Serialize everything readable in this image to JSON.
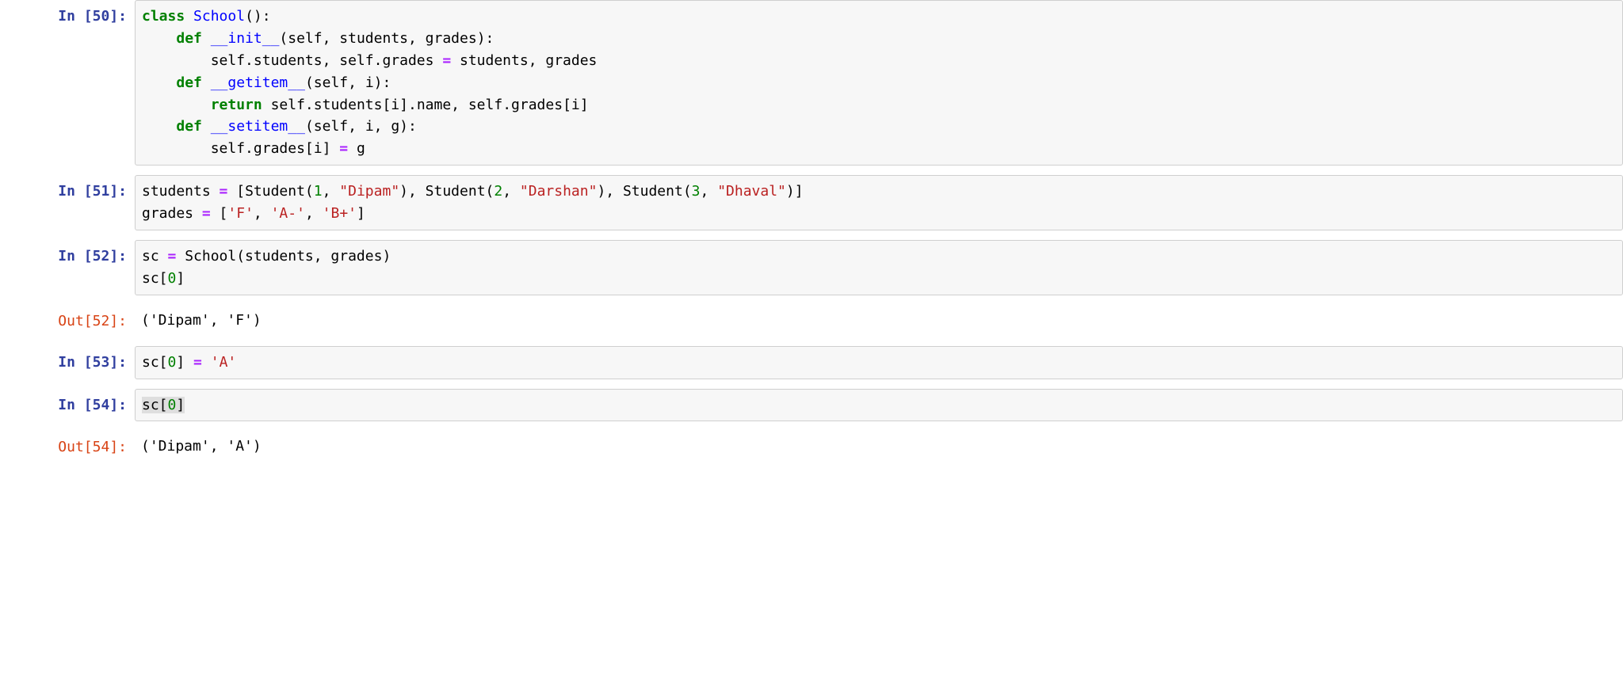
{
  "cells": [
    {
      "type": "in",
      "prompt_num": "50",
      "code_tokens": [
        {
          "t": "class",
          "c": "kw-class"
        },
        {
          "t": " ",
          "c": "py"
        },
        {
          "t": "School",
          "c": "cls-name"
        },
        {
          "t": "():",
          "c": "py"
        },
        {
          "t": "\n",
          "c": "py"
        },
        {
          "t": "    ",
          "c": "py"
        },
        {
          "t": "def",
          "c": "kw-def"
        },
        {
          "t": " ",
          "c": "py"
        },
        {
          "t": "__init__",
          "c": "func-name"
        },
        {
          "t": "(",
          "c": "py"
        },
        {
          "t": "self",
          "c": "py"
        },
        {
          "t": ", students, grades):",
          "c": "py"
        },
        {
          "t": "\n",
          "c": "py"
        },
        {
          "t": "        self",
          "c": "py"
        },
        {
          "t": ".",
          "c": "py"
        },
        {
          "t": "students, self",
          "c": "py"
        },
        {
          "t": ".",
          "c": "py"
        },
        {
          "t": "grades ",
          "c": "py"
        },
        {
          "t": "=",
          "c": "op"
        },
        {
          "t": " students, grades",
          "c": "py"
        },
        {
          "t": "\n",
          "c": "py"
        },
        {
          "t": "    ",
          "c": "py"
        },
        {
          "t": "def",
          "c": "kw-def"
        },
        {
          "t": " ",
          "c": "py"
        },
        {
          "t": "__getitem__",
          "c": "func-name"
        },
        {
          "t": "(",
          "c": "py"
        },
        {
          "t": "self",
          "c": "py"
        },
        {
          "t": ", i):",
          "c": "py"
        },
        {
          "t": "\n",
          "c": "py"
        },
        {
          "t": "        ",
          "c": "py"
        },
        {
          "t": "return",
          "c": "kw-return"
        },
        {
          "t": " self",
          "c": "py"
        },
        {
          "t": ".",
          "c": "py"
        },
        {
          "t": "students[i]",
          "c": "py"
        },
        {
          "t": ".",
          "c": "py"
        },
        {
          "t": "name, self",
          "c": "py"
        },
        {
          "t": ".",
          "c": "py"
        },
        {
          "t": "grades[i]",
          "c": "py"
        },
        {
          "t": "\n",
          "c": "py"
        },
        {
          "t": "    ",
          "c": "py"
        },
        {
          "t": "def",
          "c": "kw-def"
        },
        {
          "t": " ",
          "c": "py"
        },
        {
          "t": "__setitem__",
          "c": "func-name"
        },
        {
          "t": "(",
          "c": "py"
        },
        {
          "t": "self",
          "c": "py"
        },
        {
          "t": ", i, g):",
          "c": "py"
        },
        {
          "t": "\n",
          "c": "py"
        },
        {
          "t": "        self",
          "c": "py"
        },
        {
          "t": ".",
          "c": "py"
        },
        {
          "t": "grades[i] ",
          "c": "py"
        },
        {
          "t": "=",
          "c": "op"
        },
        {
          "t": " g",
          "c": "py"
        }
      ]
    },
    {
      "type": "in",
      "prompt_num": "51",
      "code_tokens": [
        {
          "t": "students ",
          "c": "py"
        },
        {
          "t": "=",
          "c": "op"
        },
        {
          "t": " [Student(",
          "c": "py"
        },
        {
          "t": "1",
          "c": "num"
        },
        {
          "t": ", ",
          "c": "py"
        },
        {
          "t": "\"Dipam\"",
          "c": "str"
        },
        {
          "t": "), Student(",
          "c": "py"
        },
        {
          "t": "2",
          "c": "num"
        },
        {
          "t": ", ",
          "c": "py"
        },
        {
          "t": "\"Darshan\"",
          "c": "str"
        },
        {
          "t": "), Student(",
          "c": "py"
        },
        {
          "t": "3",
          "c": "num"
        },
        {
          "t": ", ",
          "c": "py"
        },
        {
          "t": "\"Dhaval\"",
          "c": "str"
        },
        {
          "t": ")]",
          "c": "py"
        },
        {
          "t": "\n",
          "c": "py"
        },
        {
          "t": "grades ",
          "c": "py"
        },
        {
          "t": "=",
          "c": "op"
        },
        {
          "t": " [",
          "c": "py"
        },
        {
          "t": "'F'",
          "c": "str"
        },
        {
          "t": ", ",
          "c": "py"
        },
        {
          "t": "'A-'",
          "c": "str"
        },
        {
          "t": ", ",
          "c": "py"
        },
        {
          "t": "'B+'",
          "c": "str"
        },
        {
          "t": "]",
          "c": "py"
        }
      ]
    },
    {
      "type": "in",
      "prompt_num": "52",
      "code_tokens": [
        {
          "t": "sc ",
          "c": "py"
        },
        {
          "t": "=",
          "c": "op"
        },
        {
          "t": " School(students, grades)",
          "c": "py"
        },
        {
          "t": "\n",
          "c": "py"
        },
        {
          "t": "sc[",
          "c": "py"
        },
        {
          "t": "0",
          "c": "num"
        },
        {
          "t": "]",
          "c": "py"
        }
      ]
    },
    {
      "type": "out",
      "prompt_num": "52",
      "output_text": "('Dipam', 'F')"
    },
    {
      "type": "in",
      "prompt_num": "53",
      "code_tokens": [
        {
          "t": "sc[",
          "c": "py"
        },
        {
          "t": "0",
          "c": "num"
        },
        {
          "t": "] ",
          "c": "py"
        },
        {
          "t": "=",
          "c": "op"
        },
        {
          "t": " ",
          "c": "py"
        },
        {
          "t": "'A'",
          "c": "str"
        }
      ]
    },
    {
      "type": "in",
      "prompt_num": "54",
      "code_tokens": [
        {
          "t": "sc[",
          "c": "py hl"
        },
        {
          "t": "0",
          "c": "num hl"
        },
        {
          "t": "]",
          "c": "py hl"
        }
      ]
    },
    {
      "type": "out",
      "prompt_num": "54",
      "output_text": "('Dipam', 'A')"
    }
  ],
  "labels": {
    "in_prefix": "In [",
    "out_prefix": "Out[",
    "suffix": "]:"
  }
}
